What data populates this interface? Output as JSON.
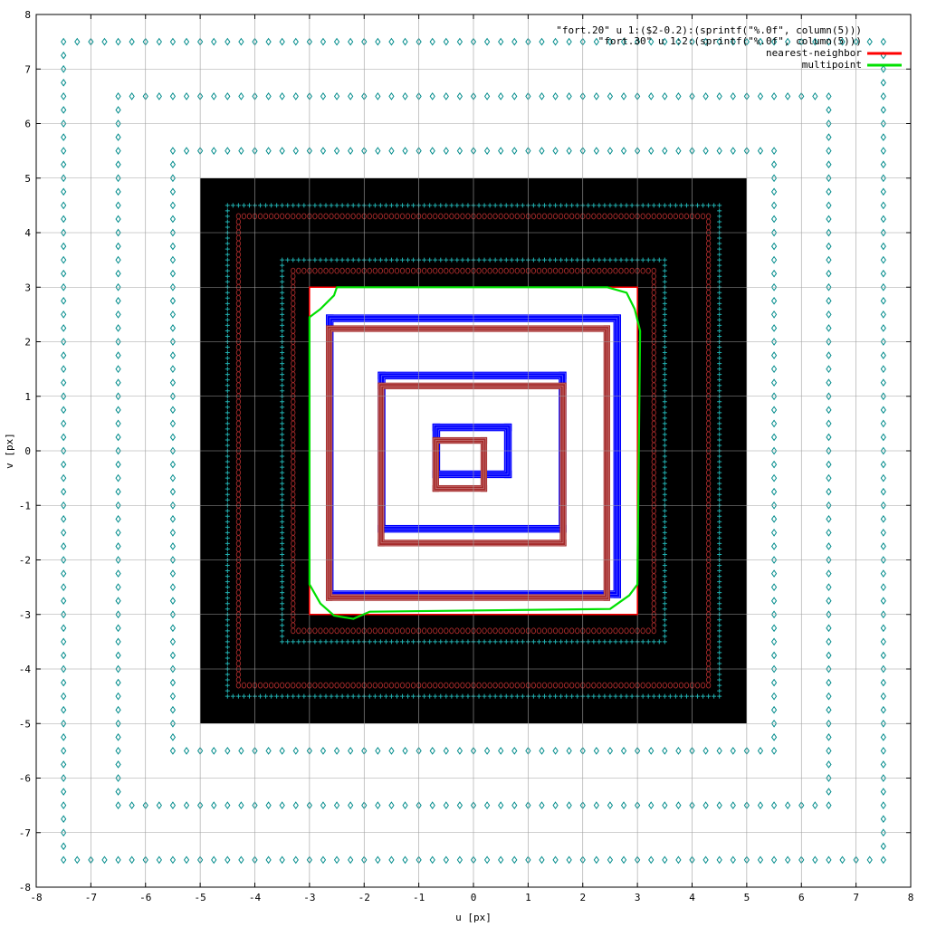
{
  "chart_data": {
    "type": "scatter",
    "xlabel": "u [px]",
    "ylabel": "v [px]",
    "xlim": [
      -8,
      8
    ],
    "ylim": [
      -8,
      8
    ],
    "xticks": [
      "-8",
      "-7",
      "-6",
      "-5",
      "-4",
      "-3",
      "-2",
      "-1",
      "0",
      "1",
      "2",
      "3",
      "4",
      "5",
      "6",
      "7",
      "8"
    ],
    "yticks": [
      "-8",
      "-7",
      "-6",
      "-5",
      "-4",
      "-3",
      "-2",
      "-1",
      "0",
      "1",
      "2",
      "3",
      "4",
      "5",
      "6",
      "7",
      "8"
    ],
    "grid": true,
    "legend_position": "top-right",
    "legend": [
      {
        "label": "\"fort.20\" u 1:($2-0.2):(sprintf(\"%.0f\", column(5)))",
        "color": "",
        "line": false
      },
      {
        "label": "\"fort.30\" u 1:2:(sprintf(\"%.0f\", column(5)))",
        "color": "",
        "line": false
      },
      {
        "label": "nearest-neighbor",
        "color": "#ff0000",
        "line": true
      },
      {
        "label": "multipoint",
        "color": "#00e000",
        "line": true
      }
    ],
    "filled_square": {
      "x": [
        -5,
        5
      ],
      "y": [
        -5,
        5
      ],
      "color": "#000000"
    },
    "white_square": {
      "x": [
        -3,
        3
      ],
      "y": [
        -3,
        3
      ],
      "color": "#ffffff"
    },
    "series": [
      {
        "name": "nearest-neighbor",
        "color": "#ff0000",
        "kind": "square-outline",
        "half_size": 3.0
      },
      {
        "name": "multipoint",
        "color": "#00e000",
        "kind": "rounded-square-outline",
        "half_size": 3.0
      }
    ],
    "marker_rings": [
      {
        "half_size": 7.5,
        "color": "#008b8b",
        "style": "diamond",
        "spacing": 0.25
      },
      {
        "half_size": 6.5,
        "color": "#008b8b",
        "style": "diamond",
        "spacing": 0.25
      },
      {
        "half_size": 5.5,
        "color": "#008b8b",
        "style": "diamond",
        "spacing": 0.25
      },
      {
        "half_size": 4.5,
        "color": "#20b0b0",
        "style": "plus",
        "spacing": 0.1
      },
      {
        "half_size": 4.3,
        "color": "#a52a2a",
        "style": "circle",
        "spacing": 0.1
      },
      {
        "half_size": 3.5,
        "color": "#20b0b0",
        "style": "plus",
        "spacing": 0.1
      },
      {
        "half_size": 3.3,
        "color": "#a52a2a",
        "style": "circle",
        "spacing": 0.1
      }
    ],
    "dense_rings": [
      {
        "x0": -2.7,
        "x1": 2.7,
        "y0": -2.7,
        "y1": 2.5,
        "thickness": 0.14,
        "color": "#0000ff"
      },
      {
        "x0": -2.7,
        "x1": 2.5,
        "y0": -2.75,
        "y1": 2.3,
        "thickness": 0.12,
        "color": "#a52a2a"
      },
      {
        "x0": -1.75,
        "x1": 1.7,
        "y0": -1.5,
        "y1": 1.45,
        "thickness": 0.14,
        "color": "#0000ff"
      },
      {
        "x0": -1.75,
        "x1": 1.7,
        "y0": -1.75,
        "y1": 1.25,
        "thickness": 0.12,
        "color": "#a52a2a"
      },
      {
        "x0": -0.75,
        "x1": 0.7,
        "y0": -0.5,
        "y1": 0.5,
        "thickness": 0.14,
        "color": "#0000ff"
      },
      {
        "x0": -0.75,
        "x1": 0.25,
        "y0": -0.75,
        "y1": 0.25,
        "thickness": 0.12,
        "color": "#a52a2a"
      }
    ]
  }
}
